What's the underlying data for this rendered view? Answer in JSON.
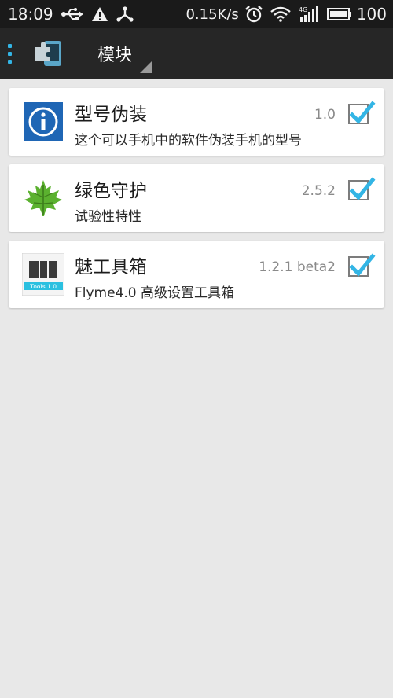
{
  "status_bar": {
    "time": "18:09",
    "speed": "0.15K/s",
    "battery": "100",
    "icons": [
      "usb-icon",
      "warning-icon",
      "share-icon",
      "alarm-icon",
      "wifi-icon",
      "signal-4g-icon",
      "battery-icon"
    ]
  },
  "action_bar": {
    "title": "模块",
    "icons": [
      "drawer-menu-icon",
      "xposed-app-icon",
      "spinner-indicator-icon"
    ]
  },
  "modules": [
    {
      "title": "型号伪装",
      "description": "这个可以手机中的软件伪装手机的型号",
      "version": "1.0",
      "enabled": true,
      "icon": "info-icon"
    },
    {
      "title": "绿色守护",
      "description": "试验性特性",
      "version": "2.5.2",
      "enabled": true,
      "icon": "maple-leaf-icon"
    },
    {
      "title": "魅工具箱",
      "description": "Flyme4.0 高级设置工具箱",
      "version": "1.2.1 beta2",
      "enabled": true,
      "icon": "toolbox-icon",
      "icon_label": "Tools 1.0"
    }
  ],
  "colors": {
    "accent": "#33b5e5",
    "status_bar_bg": "#1a1a1a",
    "action_bar_bg": "#262626",
    "page_bg": "#e8e8e8",
    "info_icon_bg": "#1f66b5",
    "leaf_green": "#5bb12f"
  }
}
